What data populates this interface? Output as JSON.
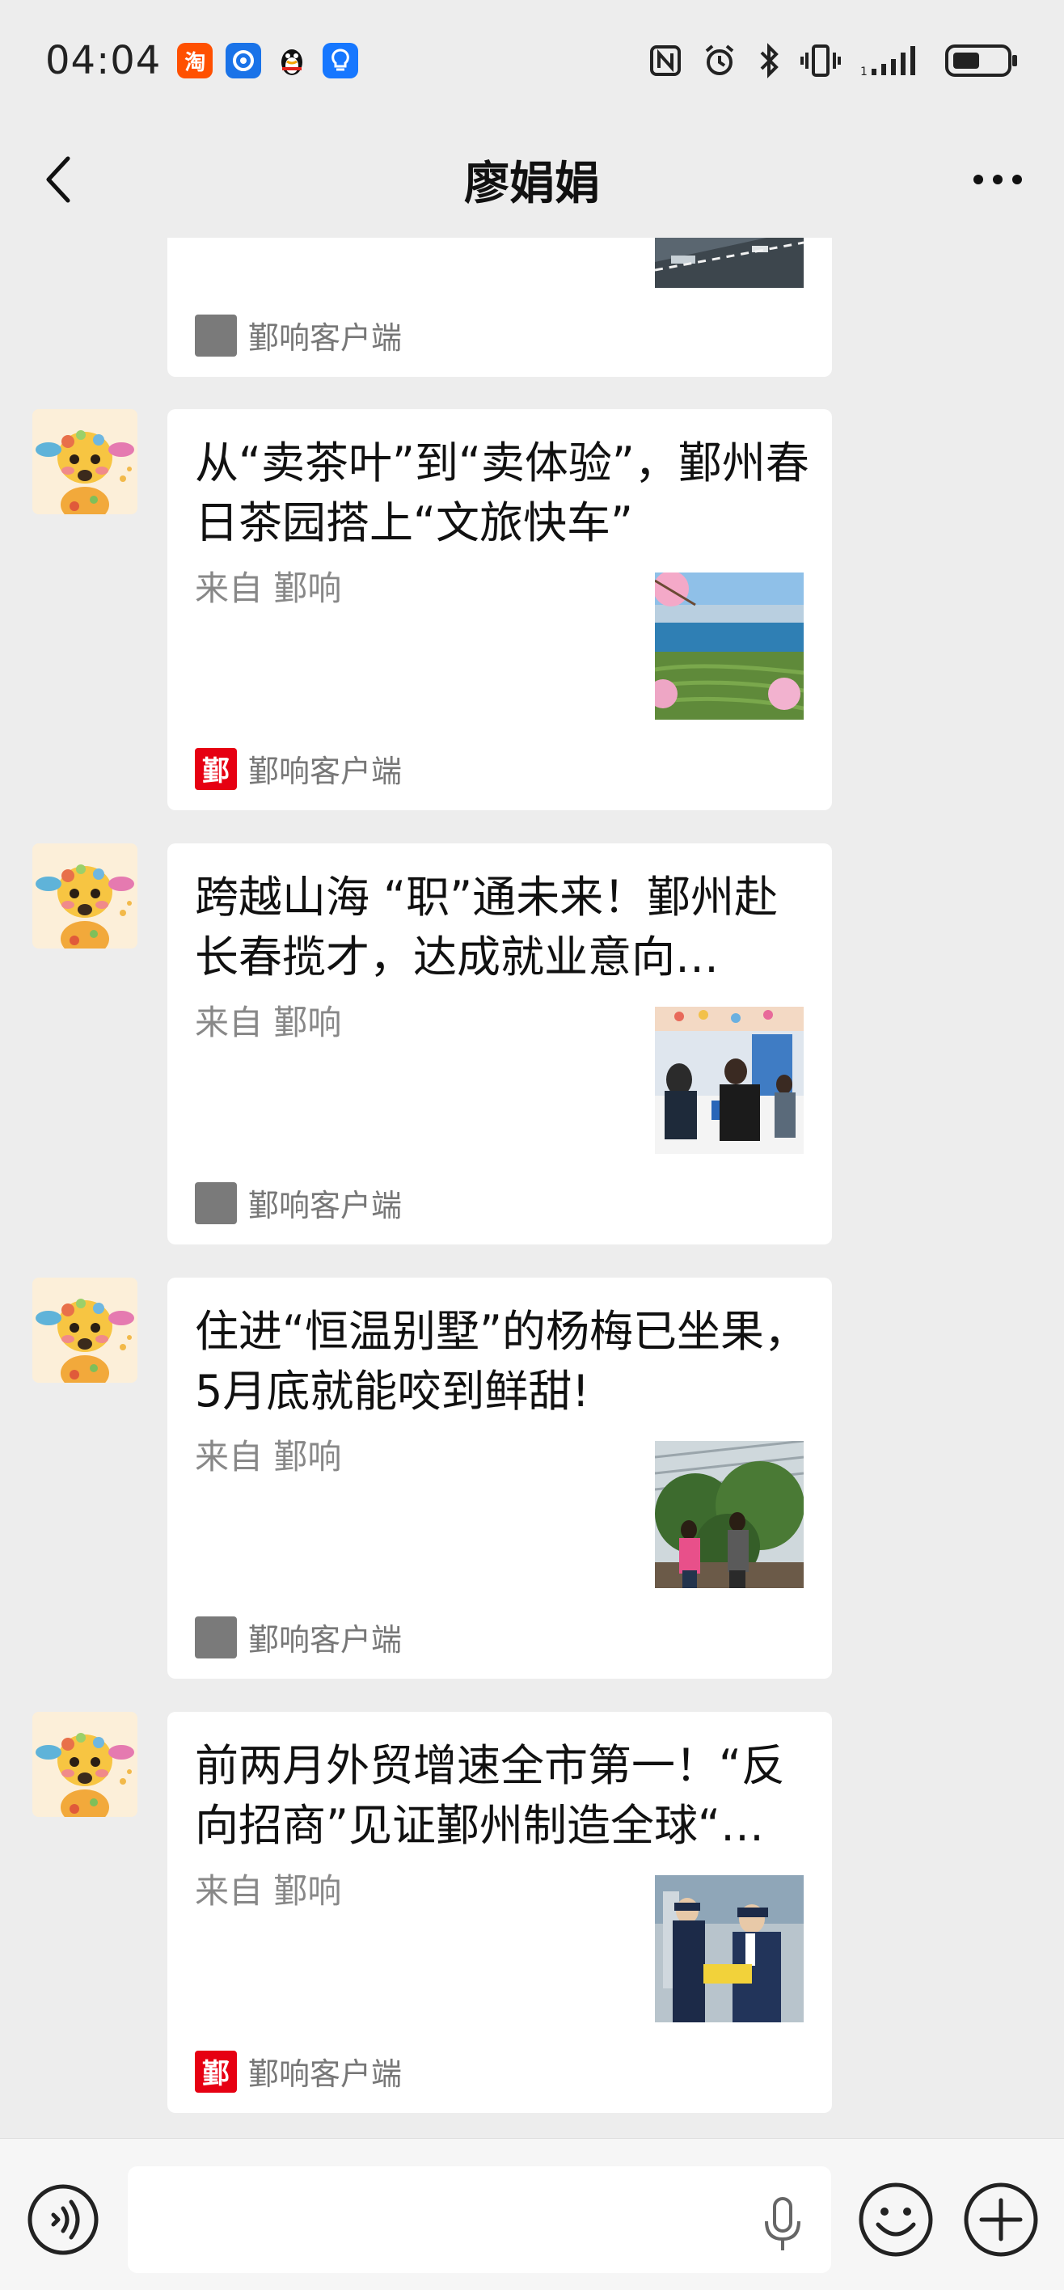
{
  "status_bar": {
    "time": "04:04",
    "apps": [
      {
        "icon": "taobao-icon",
        "glyph": "淘",
        "color": "#ff5000"
      },
      {
        "icon": "app-blue-icon",
        "glyph": "◉",
        "color": "#1a73e8"
      },
      {
        "icon": "qq-icon",
        "glyph": "🐧",
        "color": "#ffffff"
      },
      {
        "icon": "bulb-app-icon",
        "glyph": "💡",
        "color": "#1677ff"
      }
    ],
    "battery_level": 0.45
  },
  "nav": {
    "title": "廖娟娟"
  },
  "messages": [
    {
      "title": "",
      "source": "",
      "publisher": "鄞响客户端",
      "logo": "grey"
    },
    {
      "title": "从“卖茶叶”到“卖体验”，鄞州春日茶园搭上“文旅快车”",
      "source": "来自 鄞响",
      "publisher": "鄞响客户端",
      "logo": "red",
      "logo_glyph": "鄞",
      "thumb": "tea-garden-lake-photo"
    },
    {
      "title": "跨越山海 “职”通未来！鄞州赴长春揽才，达成就业意向…",
      "source": "来自 鄞响",
      "publisher": "鄞响客户端",
      "logo": "grey",
      "thumb": "job-fair-photo"
    },
    {
      "title": "住进“恒温别墅”的杨梅已坐果，5月底就能咬到鲜甜!",
      "source": "来自 鄞响",
      "publisher": "鄞响客户端",
      "logo": "grey",
      "thumb": "bayberry-greenhouse-photo"
    },
    {
      "title": "前两月外贸增速全市第一！“反向招商”见证鄞州制造全球“…",
      "source": "来自 鄞响",
      "publisher": "鄞响客户端",
      "logo": "red",
      "logo_glyph": "鄞",
      "thumb": "customs-officers-photo"
    }
  ],
  "input_bar": {
    "placeholder": "",
    "value": ""
  },
  "colors": {
    "background": "#ededed",
    "card": "#ffffff",
    "brand_red": "#e60012"
  }
}
